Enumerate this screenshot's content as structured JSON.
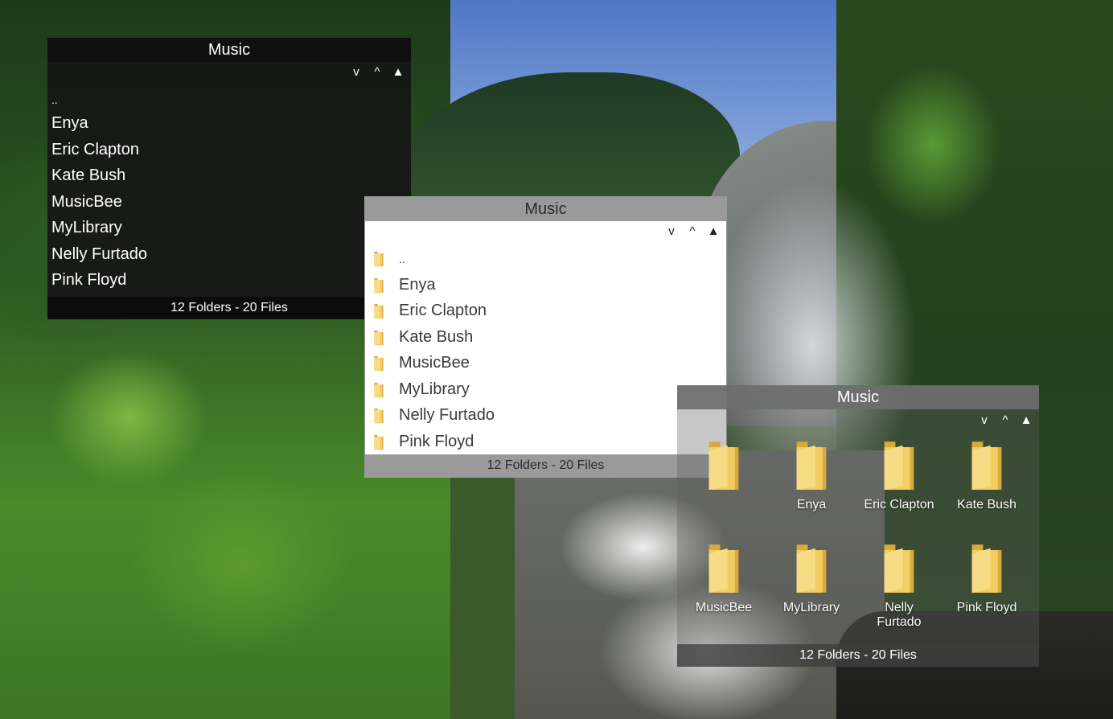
{
  "windows": {
    "dark": {
      "title": "Music",
      "controls": {
        "down": "v",
        "up": "^",
        "top": "▲"
      },
      "items": [
        "..",
        "Enya",
        "Eric Clapton",
        "Kate Bush",
        "MusicBee",
        "MyLibrary",
        "Nelly Furtado",
        "Pink Floyd"
      ],
      "status": "12 Folders - 20 Files"
    },
    "light": {
      "title": "Music",
      "controls": {
        "down": "v",
        "up": "^",
        "top": "▲"
      },
      "items": [
        "..",
        "Enya",
        "Eric Clapton",
        "Kate Bush",
        "MusicBee",
        "MyLibrary",
        "Nelly Furtado",
        "Pink Floyd"
      ],
      "status": "12 Folders - 20 Files"
    },
    "icons": {
      "title": "Music",
      "controls": {
        "down": "v",
        "up": "^",
        "top": "▲"
      },
      "tiles": [
        "",
        "Enya",
        "Eric Clapton",
        "Kate Bush",
        "MusicBee",
        "MyLibrary",
        "Nelly Furtado",
        "Pink Floyd"
      ],
      "status": "12 Folders - 20 Files"
    }
  },
  "icon_names": {
    "folder": "folder-icon"
  },
  "colors": {
    "folder": "#f3cd62",
    "folder_dark": "#d9a93a"
  }
}
